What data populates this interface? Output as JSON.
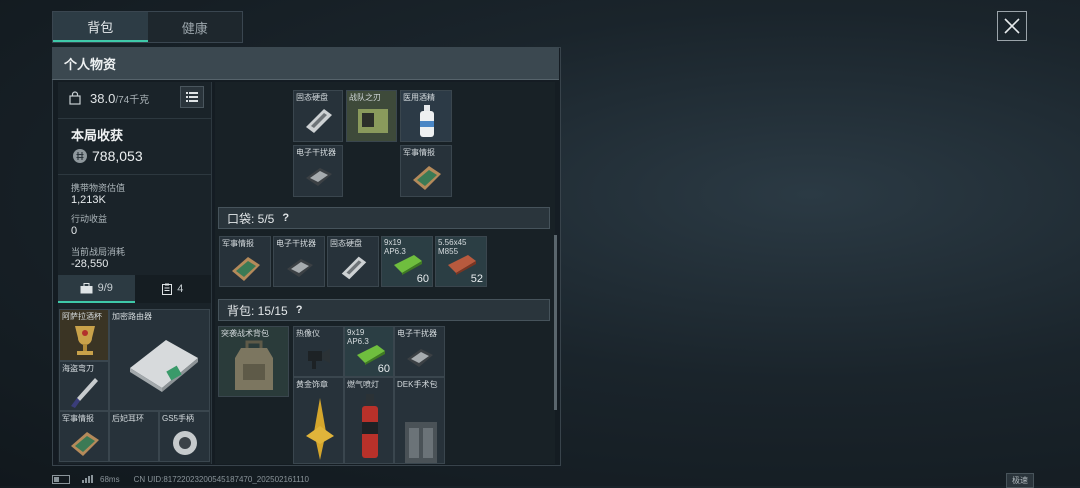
{
  "top_tabs": [
    {
      "label": "背包",
      "active": true
    },
    {
      "label": "健康",
      "active": false
    }
  ],
  "panel": {
    "title": "个人物资"
  },
  "weight": {
    "current": "38.0",
    "capacity": "/74千克"
  },
  "loot": {
    "title": "本局收获",
    "value": "788,053",
    "stats": [
      {
        "label": "携带物资估值",
        "value": "1,213K"
      },
      {
        "label": "行动收益",
        "value": "0"
      },
      {
        "label": "当前战局消耗",
        "value": "-28,550"
      }
    ]
  },
  "sub_tabs": [
    {
      "label": "9/9",
      "icon": "briefcase-icon",
      "active": true
    },
    {
      "label": "4",
      "icon": "clipboard-icon",
      "active": false
    }
  ],
  "secure_items": [
    {
      "label": "阿萨拉酒杯",
      "icon": "goblet-icon"
    },
    {
      "label": "加密路由器",
      "icon": "router-icon"
    },
    {
      "label": "海盗弯刀",
      "icon": "knife-icon"
    },
    {
      "label": "军事情报",
      "icon": "intel-icon"
    },
    {
      "label": "后妃耳环",
      "icon": "earring-icon"
    },
    {
      "label": "GS5手柄",
      "icon": "controller-icon"
    }
  ],
  "top_items": [
    {
      "label": "固态硬盘",
      "icon": "ssd-icon"
    },
    {
      "label": "战队之刃",
      "icon": "card-icon"
    },
    {
      "label": "医用酒精",
      "icon": "bottle-icon"
    },
    {
      "label": "电子干扰器",
      "icon": "jammer-icon"
    },
    {
      "label": "军事情报",
      "icon": "intel-icon"
    }
  ],
  "pocket": {
    "label": "口袋: 5/5",
    "items": [
      {
        "label": "军事情报",
        "count": "",
        "icon": "intel-icon"
      },
      {
        "label": "电子干扰器",
        "count": "",
        "icon": "jammer-icon"
      },
      {
        "label": "固态硬盘",
        "count": "",
        "icon": "ssd-icon"
      },
      {
        "label": "9x19 AP6.3",
        "count": "60",
        "icon": "ammo-green-icon"
      },
      {
        "label": "5.56x45 M855",
        "count": "52",
        "icon": "ammo-red-icon"
      }
    ]
  },
  "backpack": {
    "label": "背包: 15/15",
    "items": [
      {
        "label": "突袭战术背包",
        "count": "",
        "icon": "backpack-icon"
      },
      {
        "label": "热像仪",
        "count": "",
        "icon": "thermal-icon"
      },
      {
        "label": "9x19 AP6.3",
        "count": "60",
        "icon": "ammo-green-icon"
      },
      {
        "label": "电子干扰器",
        "count": "",
        "icon": "jammer-icon"
      },
      {
        "label": "黄金饰章",
        "count": "",
        "icon": "emblem-icon"
      },
      {
        "label": "燃气喷灯",
        "count": "",
        "icon": "torch-icon"
      },
      {
        "label": "DEK手术包",
        "count": "",
        "icon": "medkit-icon"
      }
    ]
  },
  "status": {
    "ping": "68ms",
    "uid": "CN UID:8172202320054518747​0_20250216​1110"
  },
  "corner_tag": "极速",
  "colors": {
    "accent": "#3fc9a9",
    "panel": "#141c22",
    "header": "#3b4850"
  }
}
